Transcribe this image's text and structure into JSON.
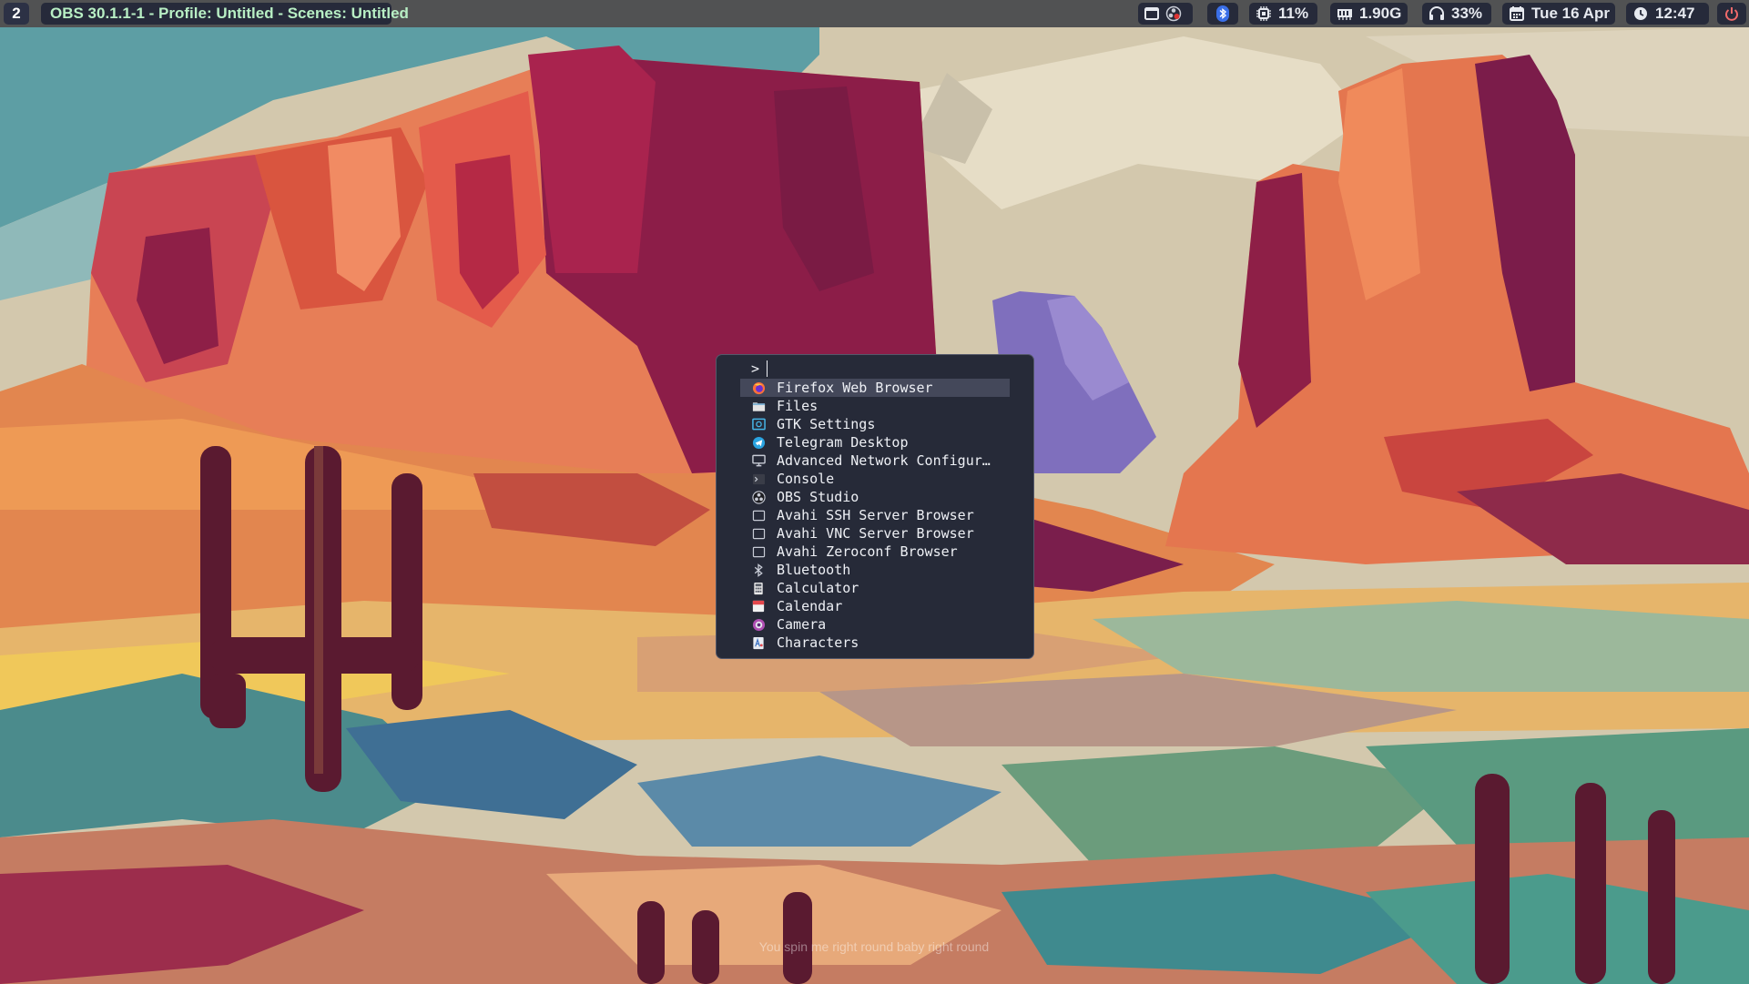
{
  "topbar": {
    "workspace": "2",
    "window_title": "OBS 30.1.1-1 - Profile: Untitled - Scenes: Untitled",
    "tray_icons": [
      "window-icon",
      "obs-tray-icon"
    ],
    "bluetooth_icon": "bluetooth-icon",
    "cpu": {
      "icon": "cpu-icon",
      "value": "11%"
    },
    "memory": {
      "icon": "memory-icon",
      "value": "1.90G"
    },
    "volume": {
      "icon": "headphones-icon",
      "value": "33%"
    },
    "date": {
      "icon": "calendar-icon",
      "value": "Tue 16 Apr"
    },
    "time": {
      "icon": "clock-icon",
      "value": "12:47"
    },
    "power_icon": "power-icon"
  },
  "launcher": {
    "prompt": ">",
    "query": "",
    "selected_index": 0,
    "items": [
      {
        "label": "Firefox Web Browser",
        "icon": "firefox-icon"
      },
      {
        "label": "Files",
        "icon": "files-icon"
      },
      {
        "label": "GTK Settings",
        "icon": "gtk-settings-icon"
      },
      {
        "label": "Telegram Desktop",
        "icon": "telegram-icon"
      },
      {
        "label": "Advanced Network Configur…",
        "icon": "network-icon"
      },
      {
        "label": "Console",
        "icon": "console-icon"
      },
      {
        "label": "OBS Studio",
        "icon": "obs-icon"
      },
      {
        "label": "Avahi SSH Server Browser",
        "icon": "avahi-ssh-icon"
      },
      {
        "label": "Avahi VNC Server Browser",
        "icon": "avahi-vnc-icon"
      },
      {
        "label": "Avahi Zeroconf Browser",
        "icon": "avahi-zeroconf-icon"
      },
      {
        "label": "Bluetooth",
        "icon": "bluetooth-icon"
      },
      {
        "label": "Calculator",
        "icon": "calculator-icon"
      },
      {
        "label": "Calendar",
        "icon": "calendar-app-icon"
      },
      {
        "label": "Camera",
        "icon": "camera-icon"
      },
      {
        "label": "Characters",
        "icon": "characters-icon"
      }
    ]
  },
  "desktop": {
    "lyric": "You spin me right round baby right round"
  },
  "colors": {
    "bar_bg": "#262a3a",
    "title_green": "#b8efc4",
    "launcher_bg": "#262a38",
    "launcher_selected": "#44485a"
  }
}
